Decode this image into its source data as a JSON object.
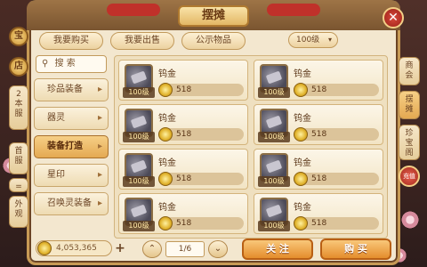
{
  "window": {
    "title": "摆摊",
    "close_label": "✕"
  },
  "top_tabs": [
    {
      "label": "我要购买"
    },
    {
      "label": "我要出售"
    },
    {
      "label": "公示物品"
    }
  ],
  "level_filter": {
    "value": "100级",
    "chevron": "▾"
  },
  "left_rail": {
    "badge_top": "宝",
    "badge_mid": "店",
    "tabs": [
      {
        "label": "2\n本\n服"
      },
      {
        "label": "首\n服"
      },
      {
        "label": "="
      },
      {
        "label": "外\n观"
      }
    ]
  },
  "search": {
    "icon": "search-icon",
    "label": "搜 索"
  },
  "categories": [
    {
      "label": "珍品装备",
      "active": false
    },
    {
      "label": "器灵",
      "active": false
    },
    {
      "label": "装备打造",
      "active": true
    },
    {
      "label": "星印",
      "active": false
    },
    {
      "label": "召唤灵装备",
      "active": false
    }
  ],
  "items": [
    {
      "name": "钨金",
      "level": "100级",
      "price": "518"
    },
    {
      "name": "钨金",
      "level": "100级",
      "price": "518"
    },
    {
      "name": "钨金",
      "level": "100级",
      "price": "518"
    },
    {
      "name": "钨金",
      "level": "100级",
      "price": "518"
    },
    {
      "name": "钨金",
      "level": "100级",
      "price": "518"
    },
    {
      "name": "钨金",
      "level": "100级",
      "price": "518"
    },
    {
      "name": "钨金",
      "level": "100级",
      "price": "518"
    },
    {
      "name": "钨金",
      "level": "100级",
      "price": "518"
    }
  ],
  "bottom": {
    "money": "4,053,365",
    "plus": "+",
    "prev": "⌃",
    "next": "⌄",
    "page": "1/6",
    "follow_label": "关 注",
    "buy_label": "购 买"
  },
  "right_rail": [
    {
      "label": "商\n会",
      "active": false
    },
    {
      "label": "摆\n摊",
      "active": true
    },
    {
      "label": "珍\n宝\n阁",
      "active": false
    }
  ],
  "right_dot": "充值"
}
